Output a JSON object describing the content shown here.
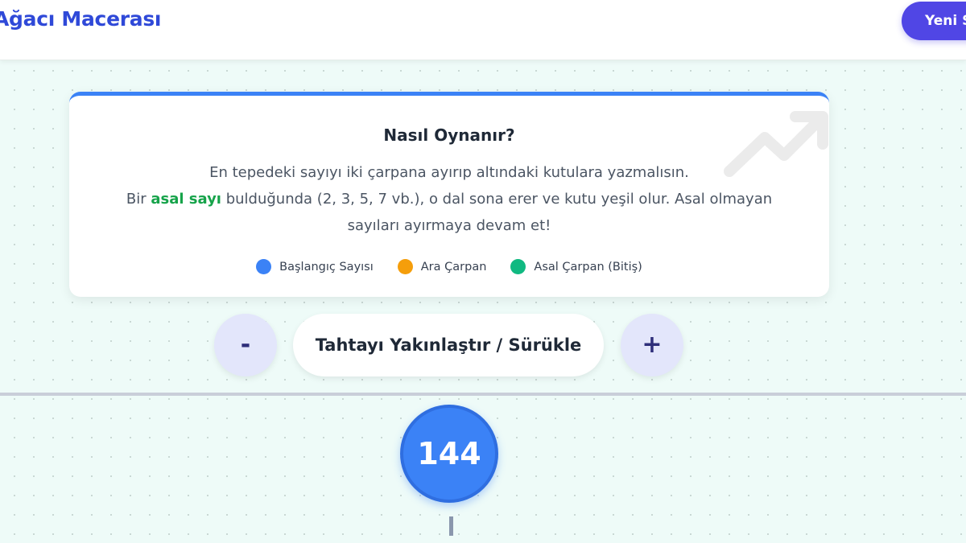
{
  "header": {
    "title": "Ağacı Macerası",
    "new_game_label": "Yeni S"
  },
  "instructions": {
    "title": "Nasıl Oynanır?",
    "line1": "En tepedeki sayıyı iki çarpana ayırıp altındaki kutulara yazmalısın.",
    "line2_prefix": "Bir ",
    "line2_highlight": "asal sayı",
    "line2_suffix": " bulduğunda (2, 3, 5, 7 vb.), o dal sona erer ve kutu yeşil olur. Asal olmayan",
    "line3": "sayıları ayırmaya devam et!",
    "legend": [
      {
        "label": "Başlangıç Sayısı",
        "color": "#3b82f6"
      },
      {
        "label": "Ara Çarpan",
        "color": "#f59e0b"
      },
      {
        "label": "Asal Çarpan (Bitiş)",
        "color": "#10b981"
      }
    ],
    "icon": "trend-up-icon"
  },
  "zoom": {
    "minus_label": "-",
    "label": "Tahtayı Yakınlaştır / Sürükle",
    "plus_label": "+"
  },
  "tree": {
    "root_value": "144"
  },
  "colors": {
    "accent": "#5046e5",
    "title": "#2f49d8",
    "start": "#3b82f6",
    "intermediate": "#f59e0b",
    "prime": "#10b981"
  }
}
